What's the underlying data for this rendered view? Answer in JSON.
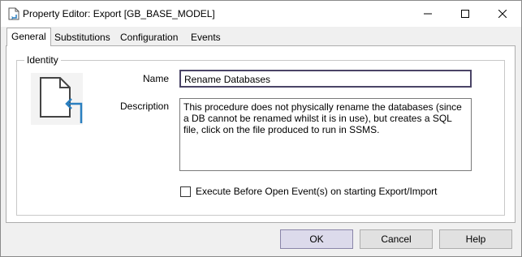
{
  "window": {
    "title": "Property Editor: Export [GB_BASE_MODEL]"
  },
  "tabs": [
    {
      "label": "General",
      "active": true
    },
    {
      "label": "Substitutions",
      "active": false
    },
    {
      "label": "Configuration",
      "active": false
    },
    {
      "label": "Events",
      "active": false
    }
  ],
  "identity": {
    "group_label": "Identity",
    "name_label": "Name",
    "name_value": "Rename Databases",
    "description_label": "Description",
    "description_value": "This procedure does not physically rename the databases (since a DB cannot be renamed whilst it is in use), but creates a SQL file, click on the file produced to run in SSMS.",
    "icon": "document-arrow-icon"
  },
  "options": {
    "execute_before_open_label": "Execute Before Open Event(s) on starting Export/Import",
    "execute_before_open_checked": false
  },
  "buttons": {
    "ok": "OK",
    "cancel": "Cancel",
    "help": "Help"
  },
  "colors": {
    "accent": "#2a7fc0",
    "default_button": "#dcdaeb"
  }
}
